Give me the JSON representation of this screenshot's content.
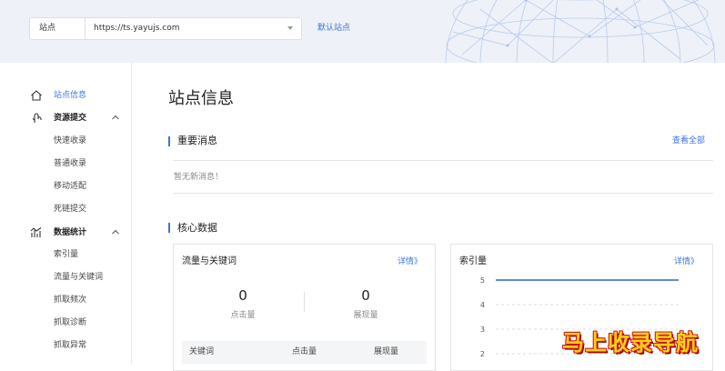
{
  "header": {
    "site_type": "站点",
    "site_url": "https://ts.yayujs.com",
    "default_site_link": "默认站点"
  },
  "sidebar": {
    "site_info": "站点信息",
    "resource_submit": {
      "label": "资源提交",
      "items": [
        "快速收录",
        "普通收录",
        "移动适配",
        "死链提交"
      ]
    },
    "data_stats": {
      "label": "数据统计",
      "items": [
        "索引量",
        "流量与关键词",
        "抓取频次",
        "抓取诊断",
        "抓取异常"
      ]
    }
  },
  "main": {
    "page_title": "站点信息",
    "messages": {
      "title": "重要消息",
      "view_all": "查看全部",
      "empty_text": "暂无新消息！"
    },
    "core_data": {
      "title": "核心数据",
      "traffic_card": {
        "title": "流量与关键词",
        "detail_link": "详情》",
        "clicks_value": "0",
        "clicks_label": "点击量",
        "impressions_value": "0",
        "impressions_label": "展现量",
        "table_headers": [
          "关键词",
          "点击量",
          "展现量"
        ]
      },
      "index_card": {
        "title": "索引量",
        "detail_link": "详情》"
      }
    }
  },
  "chart_data": {
    "type": "line",
    "title": "索引量",
    "y_ticks": [
      2,
      3,
      4,
      5
    ],
    "ylim": [
      2,
      5
    ],
    "series": [
      {
        "values": [
          5,
          5
        ]
      }
    ],
    "grid": true,
    "line_color": "#5b8ed8"
  },
  "watermark": "马上收录导航"
}
